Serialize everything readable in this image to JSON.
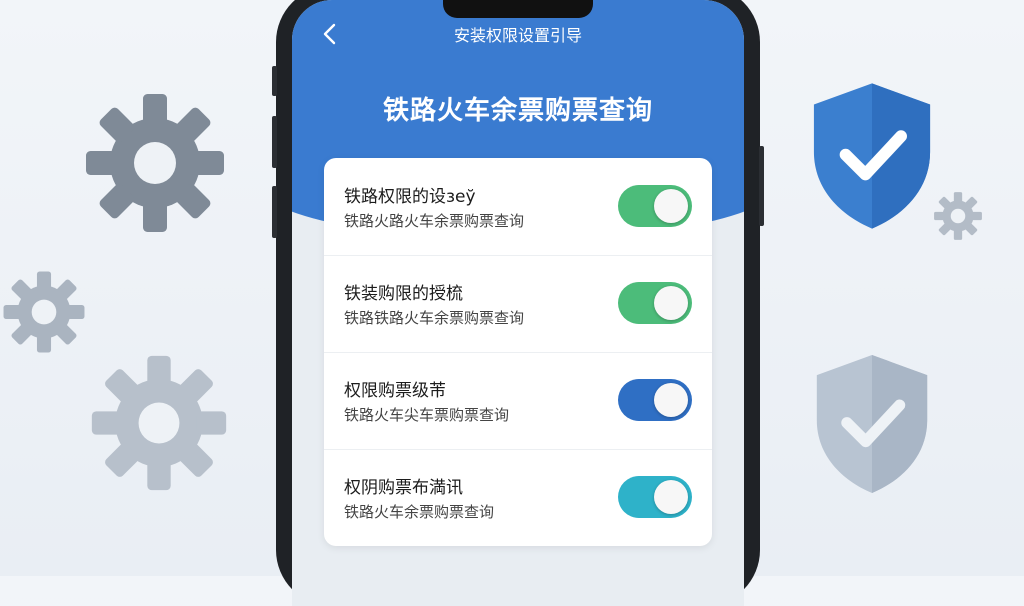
{
  "header": {
    "nav_title": "安装权限设置引导",
    "back_icon": "chevron-left-icon",
    "page_title": "铁路火车余票购票查询"
  },
  "settings": [
    {
      "title": "铁路权限的设зеў",
      "subtitle": "铁路火路火车余票购票查询",
      "on": true,
      "color": "#4cbc7a"
    },
    {
      "title": "铁装购限的授梳",
      "subtitle": "铁路铁路火车余票购票查询",
      "on": true,
      "color": "#4cbc7a"
    },
    {
      "title": "权限购票级芾",
      "subtitle": "铁路火车尖车票购票查询",
      "on": true,
      "color": "#2f6fc4"
    },
    {
      "title": "权阴购票布満讯",
      "subtitle": "铁路火车余票购票查询",
      "on": true,
      "color": "#2eb2c9"
    }
  ],
  "decorations": {
    "left_icons": [
      "gear-icon",
      "gear-icon",
      "gear-icon"
    ],
    "right_icons": [
      "shield-check-icon",
      "gear-icon",
      "shield-check-icon"
    ],
    "colors": {
      "gear": "#7f8a97",
      "shield_primary": "#3b7fcf",
      "shield_muted": "#b8c4d2"
    }
  }
}
